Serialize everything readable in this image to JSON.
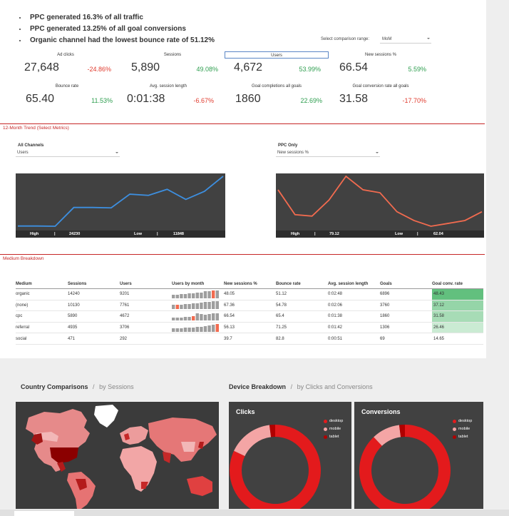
{
  "bullets": [
    "PPC generated 16.3% of all traffic",
    "PPC generated 13.25% of all goal conversions",
    "Organic channel had the lowest bounce rate of 51.12%"
  ],
  "comparison": {
    "label": "Select comparison range:",
    "value": "MoM"
  },
  "kpis": [
    {
      "label": "Ad clicks",
      "value": "27,648",
      "change": "-24.86%",
      "dir": "down"
    },
    {
      "label": "Sessions",
      "value": "5,890",
      "change": "49.08%",
      "dir": "up"
    },
    {
      "label": "Users",
      "value": "4,672",
      "change": "53.99%",
      "dir": "up"
    },
    {
      "label": "New sessions %",
      "value": "66.54",
      "change": "5.59%",
      "dir": "up"
    },
    {
      "label": "Bounce rate",
      "value": "65.40",
      "change": "11.53%",
      "dir": "up"
    },
    {
      "label": "Avg. session length",
      "value": "0:01:38",
      "change": "-6.67%",
      "dir": "down"
    },
    {
      "label": "Goal completions all goals",
      "value": "1860",
      "change": "22.69%",
      "dir": "up"
    },
    {
      "label": "Goal conversion rate all goals",
      "value": "31.58",
      "change": "-17.70%",
      "dir": "down"
    }
  ],
  "trend": {
    "title": "12-Month Trend (Select Metrics)",
    "left": {
      "filter_label": "All Channels",
      "metric": "Users",
      "high_label": "High",
      "high": "24230",
      "low_label": "Low",
      "low": "11848",
      "sep": "|"
    },
    "right": {
      "filter_label": "PPC Only",
      "metric": "New sessions %",
      "high_label": "High",
      "high": "79.12",
      "low_label": "Low",
      "low": "62.04",
      "sep": "|"
    }
  },
  "chart_data": [
    {
      "type": "line",
      "series": [
        {
          "values": [
            11900,
            11900,
            11848,
            16500,
            16500,
            16400,
            19800,
            19500,
            21000,
            18500,
            20500,
            24230
          ]
        }
      ],
      "ylim": [
        11848,
        24230
      ],
      "color": "#3d8fe0"
    },
    {
      "type": "line",
      "series": [
        {
          "values": [
            74.5,
            66.0,
            65.5,
            71.0,
            79.12,
            74.5,
            73.5,
            67.0,
            64.0,
            62.04,
            63.0,
            64.0,
            67.0
          ]
        }
      ],
      "ylim": [
        62.04,
        79.12
      ],
      "color": "#f26b4f"
    }
  ],
  "medium": {
    "title": "Medium Breakdown",
    "headers": [
      "Medium",
      "Sessions",
      "Users",
      "Users by month",
      "New sessions %",
      "Bounce rate",
      "Avg. session length",
      "Goals",
      "Goal conv. rate"
    ],
    "rows": [
      {
        "medium": "organic",
        "sessions": "14240",
        "users": "9201",
        "new_sessions": "48.05",
        "bounce": "51.12",
        "avg_len": "0:02:48",
        "goals": "6896",
        "conv": "48.43",
        "conv_color": "#62c07e",
        "hl": 10
      },
      {
        "medium": "(none)",
        "sessions": "10130",
        "users": "7761",
        "new_sessions": "67.36",
        "bounce": "54.78",
        "avg_len": "0:02:06",
        "goals": "3760",
        "conv": "37.12",
        "conv_color": "#95d5a8",
        "hl": 1
      },
      {
        "medium": "cpc",
        "sessions": "5890",
        "users": "4672",
        "new_sessions": "66.54",
        "bounce": "65.4",
        "avg_len": "0:01:38",
        "goals": "1860",
        "conv": "31.58",
        "conv_color": "#a7dcb6",
        "hl": 5
      },
      {
        "medium": "referral",
        "sessions": "4935",
        "users": "3706",
        "new_sessions": "56.13",
        "bounce": "71.25",
        "avg_len": "0:01:42",
        "goals": "1306",
        "conv": "26.46",
        "conv_color": "#caebd3",
        "hl": 11
      },
      {
        "medium": "social",
        "sessions": "471",
        "users": "292",
        "new_sessions": "39.7",
        "bounce": "82.8",
        "avg_len": "0:00:51",
        "goals": "69",
        "conv": "14.65",
        "conv_color": "#ffffff",
        "hl": -1
      }
    ]
  },
  "country": {
    "title": "Country Comparisons",
    "sep": "/",
    "sub": "by Sessions"
  },
  "device": {
    "title": "Device Breakdown",
    "sep": "/",
    "sub": "by Clicks and Conversions",
    "clicks": {
      "title": "Clicks",
      "legend": [
        "desktop",
        "mobile",
        "tablet"
      ],
      "shares": [
        0.82,
        0.16,
        0.02
      ]
    },
    "conversions": {
      "title": "Conversions",
      "legend": [
        "desktop",
        "mobile",
        "tablet"
      ],
      "shares": [
        0.88,
        0.1,
        0.02
      ]
    },
    "colors": [
      "#e31a1c",
      "#f4a5a5",
      "#b10000"
    ]
  }
}
